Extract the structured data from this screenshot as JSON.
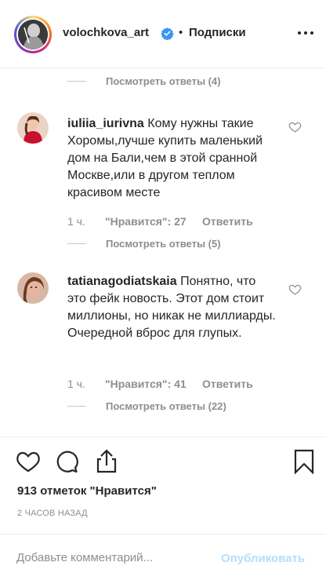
{
  "header": {
    "username": "volochkova_art",
    "separator": "•",
    "follow_label": "Подписки",
    "verified_icon": "verified-badge-icon",
    "more_icon": "more-options-icon"
  },
  "comments": [
    {
      "username": "iuliia_iurivna",
      "text": "Кому нужны такие Хоромы,лучше купить маленький дом на Бали,чем в этой сранной Москве,или в другом теплом красивом месте",
      "time": "1 ч.",
      "likes": "\"Нравится\": 27",
      "reply_label": "Ответить",
      "view_replies": "Посмотреть ответы (5)"
    },
    {
      "username": "tatianagodiatskaia",
      "text": "Понятно, что это фейк новость. Этот дом стоит миллионы, но никак не миллиарды. Очередной вброс для глупых.",
      "time": "1 ч.",
      "likes": "\"Нравится\": 41",
      "reply_label": "Ответить",
      "view_replies": "Посмотреть ответы (22)"
    }
  ],
  "top_view_replies": "Посмотреть ответы (4)",
  "post": {
    "likes_count": "913 отметок \"Нравится\"",
    "time_ago": "2 ЧАСОВ НАЗАД",
    "comment_placeholder": "Добавьте комментарий...",
    "publish_label": "Опубликовать"
  },
  "colors": {
    "text": "#262626",
    "muted": "#8e8e8e",
    "verified": "#3897f0",
    "publish_disabled": "#b2dffc"
  }
}
